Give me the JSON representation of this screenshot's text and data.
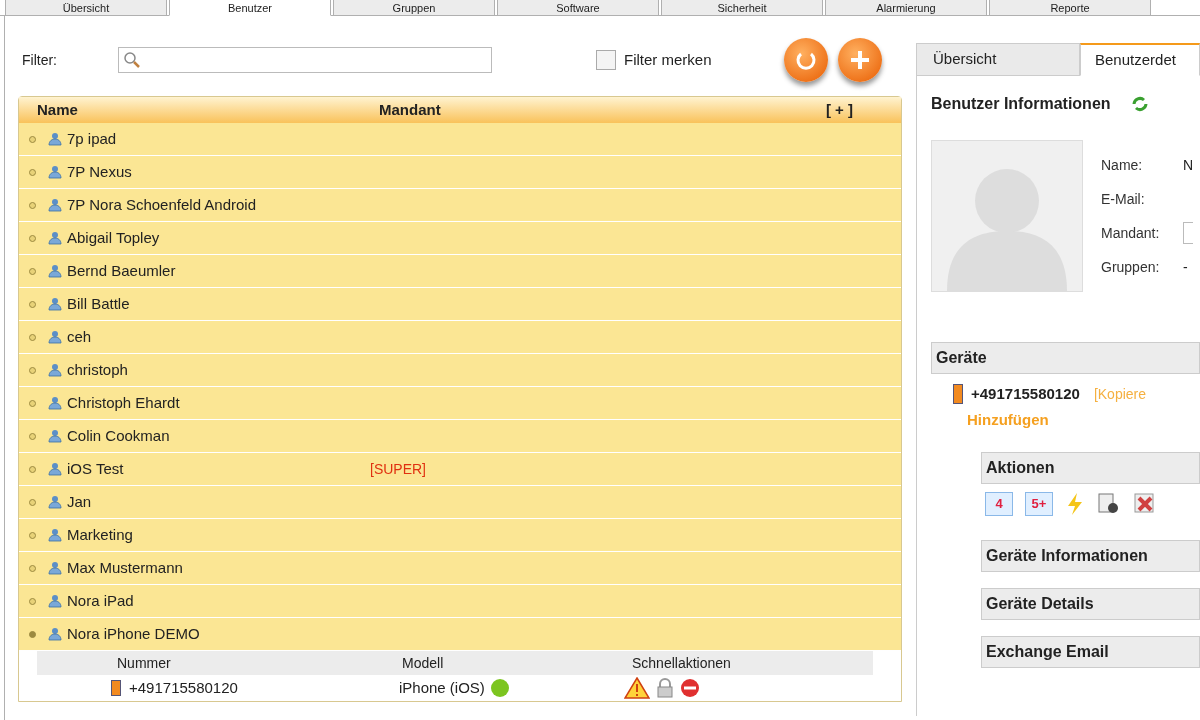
{
  "main_tabs": [
    {
      "label": "Übersicht",
      "selected": false
    },
    {
      "label": "Benutzer",
      "selected": true
    },
    {
      "label": "Gruppen",
      "selected": false
    },
    {
      "label": "Software",
      "selected": false
    },
    {
      "label": "Sicherheit",
      "selected": false
    },
    {
      "label": "Alarmierung",
      "selected": false
    },
    {
      "label": "Reporte",
      "selected": false
    }
  ],
  "filter": {
    "label": "Filter:",
    "remember_label": "Filter merken",
    "remember_checked": false
  },
  "table": {
    "columns": [
      "Name",
      "Mandant"
    ],
    "expand_all": "[ + ]",
    "rows": [
      {
        "name": "7p ipad"
      },
      {
        "name": "7P Nexus"
      },
      {
        "name": "7P Nora Schoenfeld Android"
      },
      {
        "name": "Abigail Topley"
      },
      {
        "name": "Bernd Baeumler"
      },
      {
        "name": "Bill Battle"
      },
      {
        "name": "ceh"
      },
      {
        "name": "christoph"
      },
      {
        "name": "Christoph Ehardt"
      },
      {
        "name": "Colin Cookman"
      },
      {
        "name": "iOS Test",
        "mandant": "[SUPER]"
      },
      {
        "name": "Jan"
      },
      {
        "name": "Marketing"
      },
      {
        "name": "Max Mustermann"
      },
      {
        "name": "Nora iPad"
      },
      {
        "name": "Nora iPhone DEMO",
        "device_columns": [
          "Nummer",
          "Modell",
          "Schnellaktionen"
        ],
        "devices": [
          {
            "number": "+491715580120",
            "model": "iPhone (iOS)",
            "online": true
          }
        ]
      }
    ]
  },
  "detail": {
    "tabs": [
      {
        "label": "Übersicht",
        "selected": false
      },
      {
        "label": "Benutzerdet",
        "selected": true
      }
    ],
    "title": "Benutzer Informationen",
    "fields": [
      {
        "label": "Name:",
        "value": "N"
      },
      {
        "label": "E-Mail:"
      },
      {
        "label": "Mandant:",
        "kind": "field"
      },
      {
        "label": "Gruppen:",
        "value": "-"
      }
    ],
    "devices_header": "Geräte",
    "device": {
      "number": "+491715580120",
      "copy_link": "[Kopiere"
    },
    "add_link": "Hinzufügen",
    "actions_header": "Aktionen",
    "actions": [
      {
        "label": "4"
      },
      {
        "label": "5+"
      }
    ],
    "sections": [
      "Geräte Informationen",
      "Geräte Details",
      "Exchange Email"
    ]
  }
}
